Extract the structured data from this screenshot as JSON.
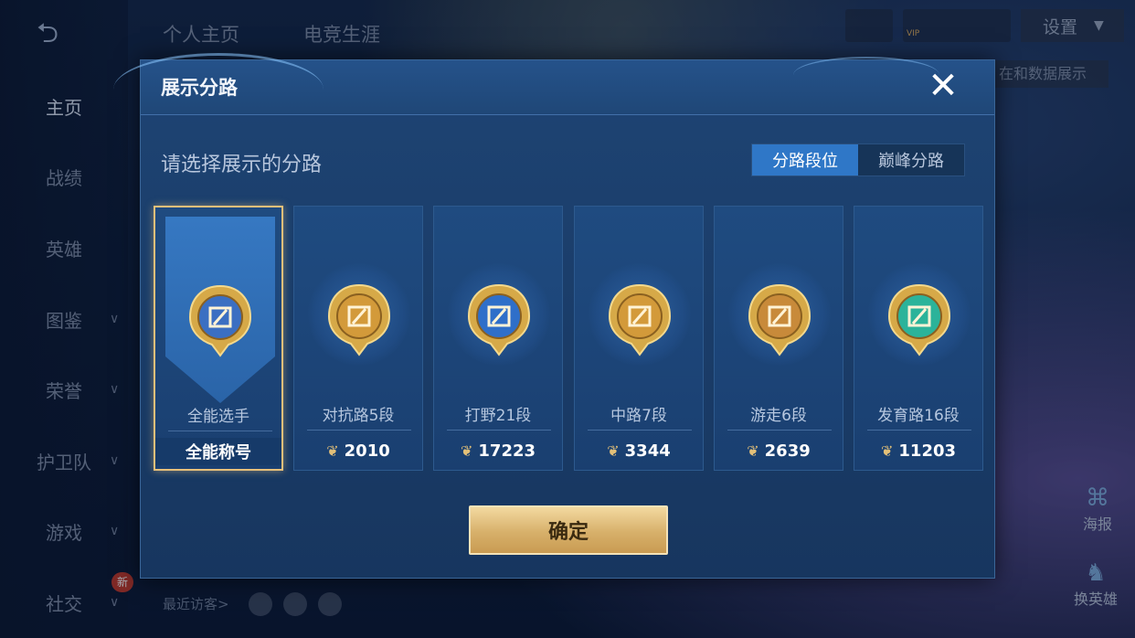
{
  "background": {
    "back_icon": "return-arrow-icon",
    "top_tabs": [
      "个人主页",
      "电竞生涯"
    ],
    "settings_label": "设置",
    "side_strip_text": "在和数据展示",
    "vip_label": "VIP",
    "nav": [
      {
        "label": "主页",
        "active": true,
        "has_chevron": false
      },
      {
        "label": "战绩",
        "active": false,
        "has_chevron": false
      },
      {
        "label": "英雄",
        "active": false,
        "has_chevron": false
      },
      {
        "label": "图鉴",
        "active": false,
        "has_chevron": true
      },
      {
        "label": "荣誉",
        "active": false,
        "has_chevron": true
      },
      {
        "label": "护卫队",
        "active": false,
        "has_chevron": true
      },
      {
        "label": "游戏",
        "active": false,
        "has_chevron": true
      },
      {
        "label": "社交",
        "active": false,
        "has_chevron": true
      }
    ],
    "new_badge": "新",
    "visitors_label": "最近访客>",
    "side_actions": [
      {
        "label": "海报",
        "icon": "poster-icon"
      },
      {
        "label": "换英雄",
        "icon": "swap-hero-icon"
      }
    ]
  },
  "modal": {
    "title": "展示分路",
    "close_icon": "close-icon",
    "subtitle": "请选择展示的分路",
    "segments": [
      {
        "label": "分路段位",
        "active": true
      },
      {
        "label": "巅峰分路",
        "active": false
      }
    ],
    "cards": [
      {
        "name": "全能选手",
        "footer": "全能称号",
        "points": null,
        "selected": true,
        "icon": "all-round-emblem-icon",
        "tone": "#3b6fc2"
      },
      {
        "name": "对抗路5段",
        "footer": null,
        "points": "2010",
        "selected": false,
        "icon": "clash-lane-emblem-icon",
        "tone": "#d39a3a"
      },
      {
        "name": "打野21段",
        "footer": null,
        "points": "17223",
        "selected": false,
        "icon": "jungle-dragon-emblem-icon",
        "tone": "#2f6fc9"
      },
      {
        "name": "中路7段",
        "footer": null,
        "points": "3344",
        "selected": false,
        "icon": "mid-lane-emblem-icon",
        "tone": "#d39a3a"
      },
      {
        "name": "游走6段",
        "footer": null,
        "points": "2639",
        "selected": false,
        "icon": "roam-wings-emblem-icon",
        "tone": "#c88a3a"
      },
      {
        "name": "发育路16段",
        "footer": null,
        "points": "11203",
        "selected": false,
        "icon": "farm-lane-emblem-icon",
        "tone": "#2bb39a"
      }
    ],
    "points_icon": "proficiency-points-icon",
    "confirm_label": "确定"
  },
  "colors": {
    "accent_blue": "#2f77c7",
    "gold": "#e7c07a",
    "modal_bg": "#1e4474"
  }
}
